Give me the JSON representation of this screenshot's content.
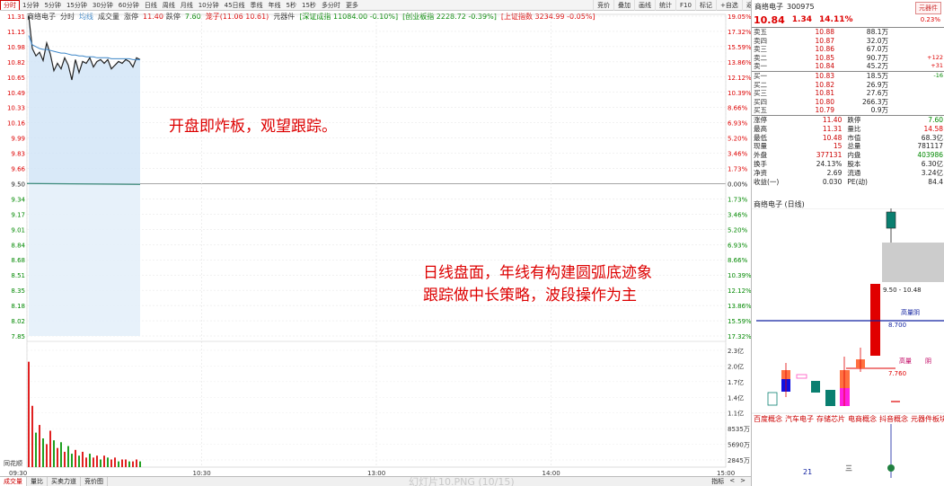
{
  "toolbar": {
    "tabs": [
      "分时",
      "1分钟",
      "5分钟",
      "15分钟",
      "30分钟",
      "60分钟",
      "日线",
      "周线",
      "月线",
      "10分钟",
      "45日线",
      "季线",
      "年线",
      "5秒",
      "15秒",
      "多分时",
      "更多"
    ],
    "active": 0,
    "tools": [
      "竞价",
      "叠加",
      "画线",
      "统计",
      "F10",
      "标记",
      "+自选",
      "返回"
    ]
  },
  "info": {
    "stock": "商络电子",
    "mode": "分时",
    "avg": "均线",
    "volume": "成交量",
    "limit_up_label": "涨停",
    "limit_up": "11.40",
    "limit_down_label": "跌停",
    "limit_down": "7.60",
    "leader": "笼子(11.06 10.61)",
    "sector": "元器件",
    "idx1": "[深证成指 11084.00 -0.10%]",
    "idx2": "[创业板指 2228.72 -0.39%]",
    "idx3": "[上证指数 3234.99 -0.05%]"
  },
  "chart_data": {
    "type": "line",
    "title": "",
    "prev_close": 9.5,
    "left_ticks": [
      "11.31",
      "11.15",
      "10.98",
      "10.82",
      "10.65",
      "10.49",
      "10.33",
      "10.16",
      "9.99",
      "9.83",
      "9.66",
      "9.50",
      "9.34",
      "9.17",
      "9.01",
      "8.84",
      "8.68",
      "8.51",
      "8.35",
      "8.18",
      "8.02",
      "7.85"
    ],
    "right_ticks": [
      "19.05%",
      "17.32%",
      "15.59%",
      "13.86%",
      "12.12%",
      "10.39%",
      "8.66%",
      "6.93%",
      "5.20%",
      "3.46%",
      "1.73%",
      "0.00%",
      "1.73%",
      "3.46%",
      "5.20%",
      "6.93%",
      "8.66%",
      "10.39%",
      "12.12%",
      "13.86%",
      "15.59%",
      "17.32%"
    ],
    "time_ticks": [
      "09:30",
      "10:30",
      "13:00",
      "14:00",
      "15:00"
    ],
    "price": [
      11.31,
      10.96,
      10.88,
      10.92,
      10.83,
      11.02,
      10.9,
      10.72,
      10.8,
      10.74,
      10.86,
      10.78,
      10.62,
      10.84,
      10.7,
      10.82,
      10.8,
      10.86,
      10.76,
      10.82,
      10.84,
      10.8,
      10.84,
      10.74,
      10.78,
      10.82,
      10.8,
      10.84,
      10.82,
      10.76,
      10.86,
      10.84
    ],
    "avg": [
      11.1,
      11.0,
      10.98,
      10.96,
      10.95,
      10.95,
      10.94,
      10.93,
      10.92,
      10.91,
      10.91,
      10.9,
      10.89,
      10.89,
      10.88,
      10.88,
      10.87,
      10.87,
      10.87,
      10.86,
      10.86,
      10.86,
      10.86,
      10.85,
      10.85,
      10.85,
      10.85,
      10.85,
      10.85,
      10.84,
      10.84,
      10.84
    ],
    "volume_ticks": [
      "2.3亿",
      "2.0亿",
      "1.7亿",
      "1.4亿",
      "1.1亿",
      "8535万",
      "5690万",
      "2845万"
    ],
    "volumes": [
      0.55,
      0.32,
      0.18,
      0.22,
      0.15,
      0.12,
      0.19,
      0.14,
      0.1,
      0.13,
      0.08,
      0.11,
      0.07,
      0.09,
      0.06,
      0.08,
      0.05,
      0.07,
      0.05,
      0.06,
      0.04,
      0.06,
      0.05,
      0.04,
      0.05,
      0.03,
      0.04,
      0.04,
      0.03,
      0.03,
      0.04,
      0.03
    ],
    "vol_colors": [
      "red",
      "red",
      "green",
      "red",
      "green",
      "red",
      "red",
      "green",
      "red",
      "green",
      "red",
      "green",
      "green",
      "red",
      "green",
      "red",
      "red",
      "green",
      "red",
      "red",
      "green",
      "red",
      "green",
      "red",
      "red",
      "green",
      "red",
      "red",
      "green",
      "red",
      "red",
      "green"
    ],
    "volume_max": 2.3
  },
  "annotations": {
    "line1": "开盘即炸板，观望跟踪。",
    "line2": "日线盘面，年线有构建圆弧底迹象",
    "line3": "跟踪做中长策略，波段操作为主"
  },
  "bottombar": {
    "tabs": [
      "成交量",
      "量比",
      "买卖力道",
      "竞价图"
    ],
    "active": 0,
    "right": [
      "指标",
      "<",
      ">"
    ],
    "corner": "同花顺",
    "watermark": "幻灯片10.PNG (10/15)"
  },
  "quote": {
    "name": "商络电子",
    "code": "300975",
    "badge": "元器件",
    "badge_pct": "0.23%",
    "price": "10.84",
    "change": "1.34",
    "pct": "14.11%",
    "asks": [
      {
        "label": "卖五",
        "price": "10.88",
        "vol": "88.1万",
        "chg": ""
      },
      {
        "label": "卖四",
        "price": "10.87",
        "vol": "32.0万",
        "chg": ""
      },
      {
        "label": "卖三",
        "price": "10.86",
        "vol": "67.0万",
        "chg": ""
      },
      {
        "label": "卖二",
        "price": "10.85",
        "vol": "90.7万",
        "chg": "+122"
      },
      {
        "label": "卖一",
        "price": "10.84",
        "vol": "45.2万",
        "chg": "+31"
      }
    ],
    "bids": [
      {
        "label": "买一",
        "price": "10.83",
        "vol": "18.5万",
        "chg": "-16"
      },
      {
        "label": "买二",
        "price": "10.82",
        "vol": "26.9万",
        "chg": ""
      },
      {
        "label": "买三",
        "price": "10.81",
        "vol": "27.6万",
        "chg": ""
      },
      {
        "label": "买四",
        "price": "10.80",
        "vol": "266.3万",
        "chg": ""
      },
      {
        "label": "买五",
        "price": "10.79",
        "vol": "0.9万",
        "chg": ""
      }
    ],
    "stats": [
      [
        "涨停",
        "11.40",
        "跌停",
        "7.60"
      ],
      [
        "最高",
        "11.31",
        "量比",
        "14.58"
      ],
      [
        "最低",
        "10.48",
        "市值",
        "68.3亿"
      ],
      [
        "现量",
        "15",
        "总量",
        "781117"
      ],
      [
        "外盘",
        "377131",
        "内盘",
        "403986"
      ],
      [
        "换手",
        "24.13%",
        "股本",
        "6.30亿"
      ],
      [
        "净资",
        "2.69",
        "流通",
        "3.24亿"
      ],
      [
        "收益(一)",
        "0.030",
        "PE(动)",
        "84.4"
      ]
    ]
  },
  "kline": {
    "title": "商络电子 (日线)",
    "label_range": "9.50 - 10.48",
    "label_high": "高量阴",
    "label_8700": "8.700",
    "label_high2": "高量",
    "label_yin": "阴",
    "label_7760": "7.760",
    "concepts": [
      "百度概念",
      "汽车电子",
      "存储芯片",
      "电商概念",
      "抖音概念",
      "元器件板块"
    ],
    "bottom_num": "21",
    "bottom_three": "三"
  },
  "colors": {
    "up": "#e00000",
    "down": "#008000",
    "grid": "#d0d0d0",
    "line": "#222222",
    "avg": "#3c86c8"
  }
}
